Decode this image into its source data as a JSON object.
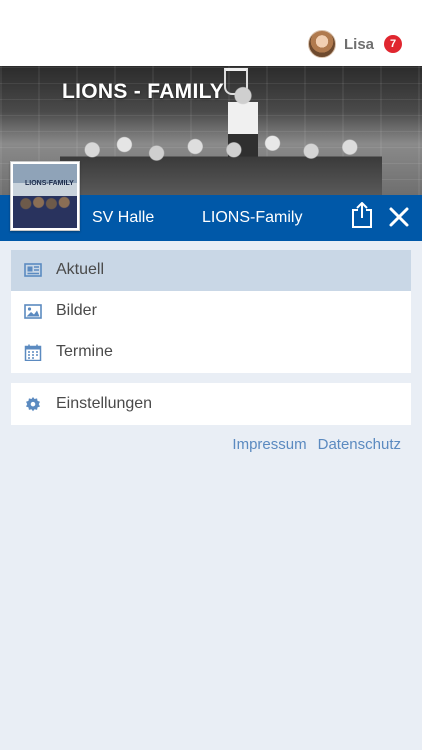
{
  "user": {
    "name": "Lisa",
    "notifications": "7"
  },
  "banner": {
    "title": "LIONS - FAMILY",
    "logo_caption": "LIONS-FAMILY"
  },
  "nav": {
    "left_label": "SV Halle",
    "center_label": "LIONS-Family"
  },
  "menu": {
    "items": [
      {
        "label": "Aktuell",
        "icon": "newspaper-icon",
        "active": true
      },
      {
        "label": "Bilder",
        "icon": "image-icon",
        "active": false
      },
      {
        "label": "Termine",
        "icon": "calendar-icon",
        "active": false
      }
    ],
    "settings": {
      "label": "Einstellungen",
      "icon": "gear-icon"
    }
  },
  "footer": {
    "impressum": "Impressum",
    "datenschutz": "Datenschutz"
  },
  "colors": {
    "primary": "#0058a8",
    "icon": "#5b8ac0",
    "active_bg": "#c9d7e6",
    "badge": "#e0262f"
  }
}
